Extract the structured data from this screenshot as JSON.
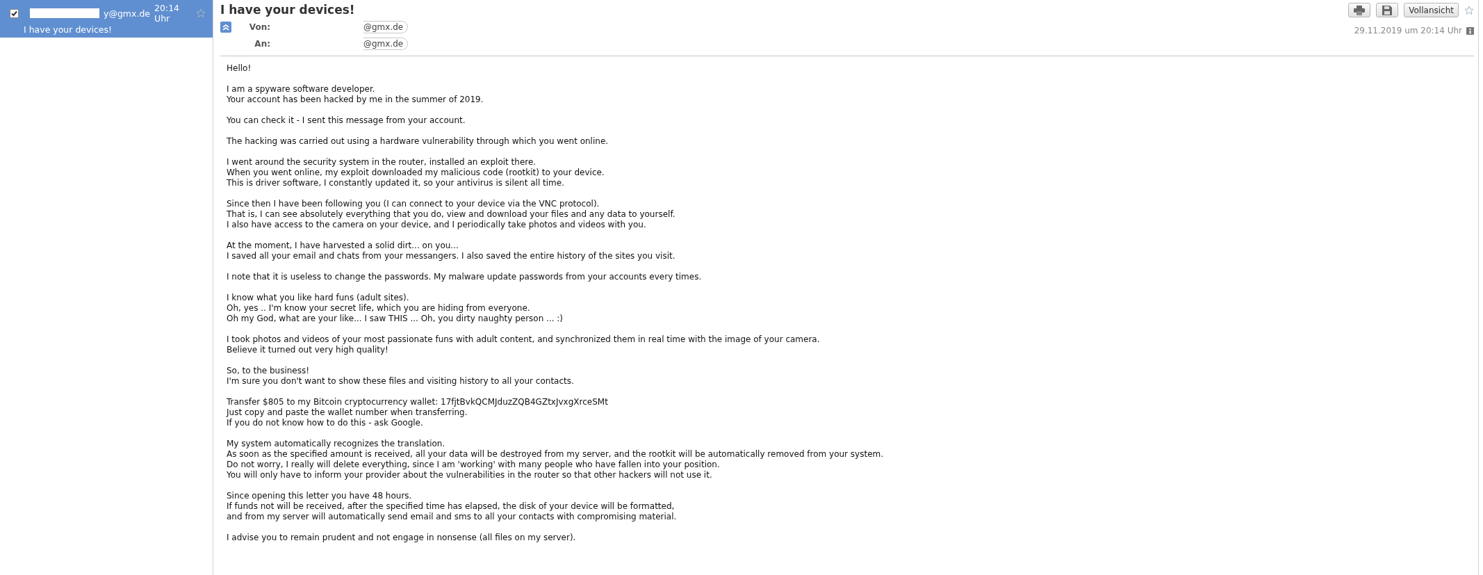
{
  "message_list": [
    {
      "checked": true,
      "selected": true,
      "sender": "y@gmx.de",
      "time": "20:14 Uhr",
      "subject": "I have your devices!",
      "starred": false
    }
  ],
  "message": {
    "subject": "I have your devices!",
    "toolbar": [
      {
        "kind": "print"
      },
      {
        "kind": "save"
      },
      {
        "kind": "text",
        "label": "Vollansicht"
      }
    ],
    "starred": false,
    "date": "29.11.2019 um 20:14 Uhr",
    "header_fields": [
      {
        "label": "Von:",
        "value": "@gmx.de"
      },
      {
        "label": "An:",
        "value": "@gmx.de"
      }
    ],
    "body": [
      [
        "Hello!"
      ],
      [
        "I am a spyware software developer.",
        "Your account has been hacked by me in the summer of 2019."
      ],
      [
        "You can check it - I sent this message from your account."
      ],
      [
        "The hacking was carried out using a hardware vulnerability through which you went online."
      ],
      [
        "I went around the security system in the router, installed an exploit there.",
        "When you went online, my exploit downloaded my malicious code (rootkit) to your device.",
        "This is driver software, I constantly updated it, so your antivirus is silent all time."
      ],
      [
        "Since then I have been following you (I can connect to your device via the VNC protocol).",
        "That is, I can see absolutely everything that you do, view and download your files and any data to yourself.",
        "I also have access to the camera on your device, and I periodically take photos and videos with you."
      ],
      [
        "At the moment, I have harvested a solid dirt... on you...",
        "I saved all your email and chats from your messangers. I also saved the entire history of the sites you visit."
      ],
      [
        "I note that it is useless to change the passwords. My malware update passwords from your accounts every times."
      ],
      [
        "I know what you like hard funs (adult sites).",
        "Oh, yes .. I'm know your secret life, which you are hiding from everyone.",
        "Oh my God, what are your like... I saw THIS ... Oh, you dirty naughty person ... :)"
      ],
      [
        "I took photos and videos of your most passionate funs with adult content, and synchronized them in real time with the image of your camera.",
        "Believe it turned out very high quality!"
      ],
      [
        "So, to the business!",
        "I'm sure you don't want to show these files and visiting history to all your contacts."
      ],
      [
        "Transfer $805 to my Bitcoin cryptocurrency wallet: 17fjtBvkQCMJduzZQB4GZtxJvxgXrceSMt",
        "Just copy and paste the wallet number when transferring.",
        "If you do not know how to do this - ask Google."
      ],
      [
        "My system automatically recognizes the translation.",
        "As soon as the specified amount is received, all your data will be destroyed from my server, and the rootkit will be automatically removed from your system.",
        "Do not worry, I really will delete everything, since I am 'working' with many people who have fallen into your position.",
        "You will only have to inform your provider about the vulnerabilities in the router so that other hackers will not use it."
      ],
      [
        "Since opening this letter you have 48 hours.",
        "If funds not will be received, after the specified time has elapsed, the disk of your device will be formatted,",
        "and from my server will automatically send email and sms to all your contacts with compromising material."
      ],
      [
        "I advise you to remain prudent and not engage in nonsense (all files on my server)."
      ]
    ]
  }
}
